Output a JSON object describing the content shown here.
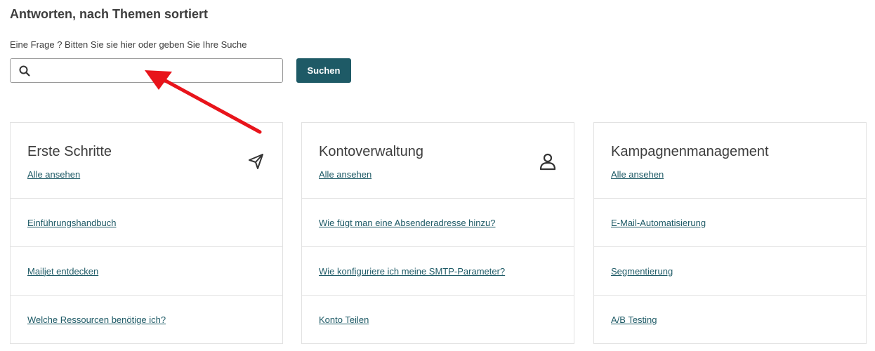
{
  "header": {
    "title": "Antworten, nach Themen sortiert",
    "search_label": "Eine Frage ? Bitten Sie sie hier oder geben Sie Ihre Suche",
    "search_value": "",
    "search_button": "Suchen"
  },
  "cards": [
    {
      "title": "Erste Schritte",
      "view_all": "Alle ansehen",
      "icon": "paper-plane-icon",
      "links": [
        "Einführungshandbuch",
        "Mailjet entdecken",
        "Welche Ressourcen benötige ich?"
      ]
    },
    {
      "title": "Kontoverwaltung",
      "view_all": "Alle ansehen",
      "icon": "user-icon",
      "links": [
        "Wie fügt man eine Absenderadresse hinzu?",
        "Wie konfiguriere ich meine SMTP-Parameter?",
        "Konto Teilen"
      ]
    },
    {
      "title": "Kampagnenmanagement",
      "view_all": "Alle ansehen",
      "icon": "",
      "links": [
        "E-Mail-Automatisierung",
        "Segmentierung",
        "A/B Testing"
      ]
    }
  ],
  "colors": {
    "accent": "#1e5a66",
    "annotation_arrow": "#e8141b"
  }
}
